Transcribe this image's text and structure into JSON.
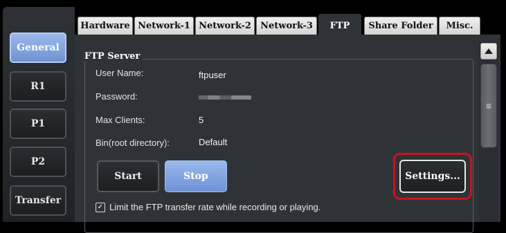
{
  "sidebar": {
    "items": [
      {
        "label": "General",
        "active": true
      },
      {
        "label": "R1",
        "active": false
      },
      {
        "label": "P1",
        "active": false
      },
      {
        "label": "P2",
        "active": false
      },
      {
        "label": "Transfer",
        "active": false
      }
    ]
  },
  "tabs": [
    {
      "label": "Hardware",
      "active": false
    },
    {
      "label": "Network-1",
      "active": false
    },
    {
      "label": "Network-2",
      "active": false
    },
    {
      "label": "Network-3",
      "active": false
    },
    {
      "label": "FTP",
      "active": true
    },
    {
      "label": "Share Folder",
      "active": false
    },
    {
      "label": "Misc.",
      "active": false
    }
  ],
  "ftp_server": {
    "title": "FTP Server",
    "fields": [
      {
        "label": "User Name:",
        "value": "ftpuser"
      },
      {
        "label": "Password:",
        "value": ""
      },
      {
        "label": "Max Clients:",
        "value": "5"
      },
      {
        "label": "Bin(root directory):",
        "value": "Default"
      }
    ],
    "start_label": "Start",
    "stop_label": "Stop",
    "settings_label": "Settings...",
    "limit_rate_label": "Limit the FTP transfer rate while recording or playing.",
    "limit_rate_checked": true
  },
  "colors": {
    "accent_blue": "#7f9fdd",
    "highlight_red": "#c8141c",
    "panel_bg": "#2f3338"
  },
  "icons": {
    "scroll_up": "triangle-up-icon",
    "scroll_grip": "grip-lines-icon",
    "checkbox": "checkmark-icon"
  }
}
